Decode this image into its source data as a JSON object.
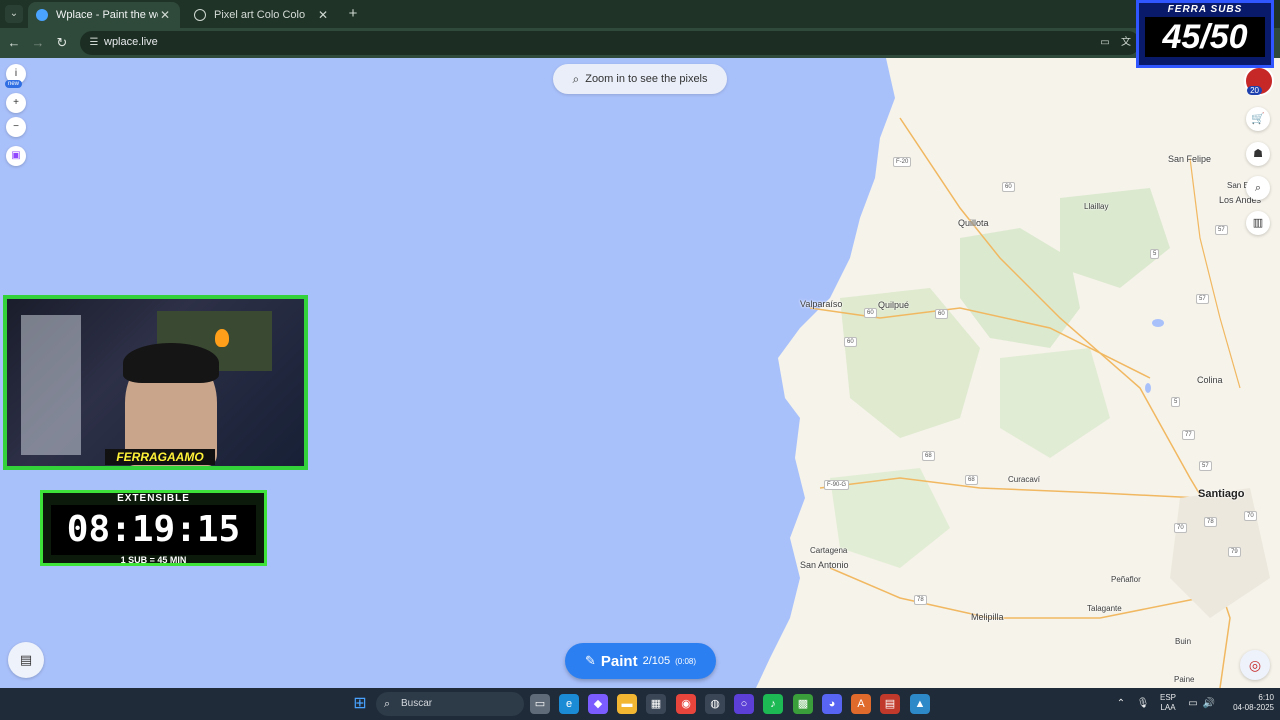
{
  "browser": {
    "tabs": [
      {
        "label": "Wplace - Paint the world",
        "active": true
      },
      {
        "label": "Pixel art Colo Colo",
        "active": false
      }
    ],
    "url": "wplace.live"
  },
  "map": {
    "zoom_hint": "Zoom in to see the pixels",
    "new_badge": "new",
    "paint": {
      "label": "Paint",
      "charges": "2/105",
      "timer": "(0:08)"
    },
    "user_level": "20",
    "places": [
      "Quillota",
      "Quilpué",
      "Valparaíso",
      "Llaillay",
      "San Felipe",
      "San E",
      "Los Andes",
      "Colina",
      "Curacaví",
      "Santiago",
      "Cartagena",
      "San Antonio",
      "Melipilla",
      "Talagante",
      "Peñaflor",
      "Buin",
      "Paine"
    ],
    "road_numbers": [
      "F-20",
      "60",
      "60",
      "60",
      "60",
      "F-90-G",
      "68",
      "68",
      "57",
      "57",
      "5",
      "5",
      "77",
      "57",
      "70",
      "78",
      "70",
      "79",
      "78"
    ],
    "icons": {
      "info": "info-icon",
      "zoom_in": "plus-icon",
      "zoom_out": "minus-icon",
      "twitch": "twitch-icon",
      "shop": "cart-icon",
      "people": "group-icon",
      "search": "search-icon",
      "leaderboard": "bar-chart-icon",
      "locate": "locate-icon",
      "layers": "layers-icon"
    }
  },
  "overlays": {
    "streamer_name": "FERRAGAAMO",
    "timer": {
      "top": "EXTENSIBLE",
      "value": "08:19:15",
      "bottom": "1 SUB = 45 MIN"
    },
    "subs": {
      "title": "FERRA SUBS",
      "count": "45/50"
    }
  },
  "taskbar": {
    "search_label": "Buscar",
    "lang": "ESP",
    "layout": "LAA",
    "time": "6:10",
    "date": "04-08-2025"
  }
}
